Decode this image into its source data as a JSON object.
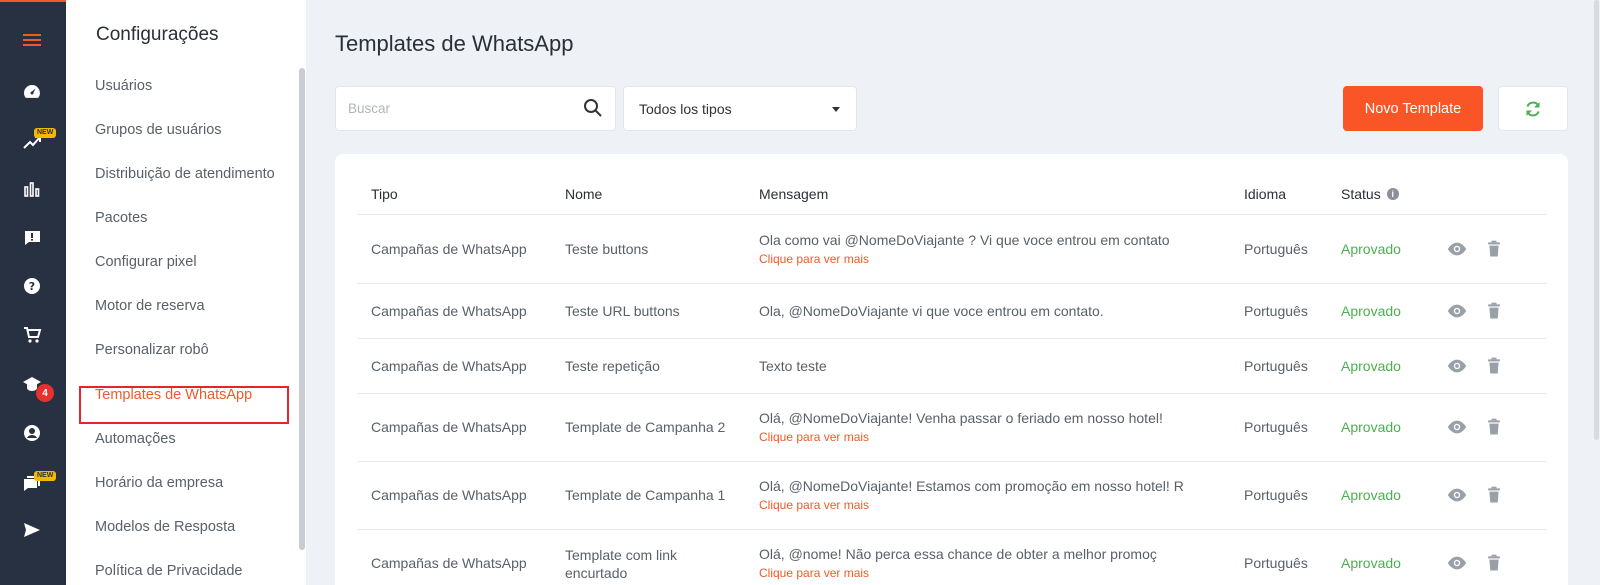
{
  "rail": {
    "new_badge": "NEW",
    "notification_count": "4",
    "colors": {
      "background": "#273142",
      "accent": "#f05a28"
    }
  },
  "settings": {
    "title": "Configurações",
    "items": [
      {
        "label": "Usuários"
      },
      {
        "label": "Grupos de usuários"
      },
      {
        "label": "Distribuição de atendimento"
      },
      {
        "label": "Pacotes"
      },
      {
        "label": "Configurar pixel"
      },
      {
        "label": "Motor de reserva"
      },
      {
        "label": "Personalizar robô"
      },
      {
        "label": "Templates de WhatsApp"
      },
      {
        "label": "Automações"
      },
      {
        "label": "Horário da empresa"
      },
      {
        "label": "Modelos de Resposta"
      },
      {
        "label": "Política de Privacidade"
      }
    ],
    "active_item": "Templates de WhatsApp"
  },
  "main": {
    "title": "Templates de WhatsApp",
    "search": {
      "placeholder": "Buscar",
      "value": ""
    },
    "type_filter": {
      "selected": "Todos los tipos"
    },
    "new_button": "Novo Template",
    "table": {
      "headers": {
        "tipo": "Tipo",
        "nome": "Nome",
        "mensagem": "Mensagem",
        "idioma": "Idioma",
        "status": "Status"
      },
      "rows": [
        {
          "tipo": "Campañas de WhatsApp",
          "nome": "Teste buttons",
          "mensagem": "Ola como vai @NomeDoViajante ? Vi que voce entrou em contato",
          "more": "Clique para ver mais",
          "idioma": "Português",
          "status": "Aprovado"
        },
        {
          "tipo": "Campañas de WhatsApp",
          "nome": "Teste URL buttons",
          "mensagem": "Ola, @NomeDoViajante vi que voce entrou em contato.",
          "more": "",
          "idioma": "Português",
          "status": "Aprovado"
        },
        {
          "tipo": "Campañas de WhatsApp",
          "nome": "Teste repetição",
          "mensagem": "Texto teste",
          "more": "",
          "idioma": "Português",
          "status": "Aprovado"
        },
        {
          "tipo": "Campañas de WhatsApp",
          "nome": "Template de Campanha 2",
          "mensagem": "Olá, @NomeDoViajante! Venha passar o feriado em nosso hotel!",
          "more": "Clique para ver mais",
          "idioma": "Português",
          "status": "Aprovado"
        },
        {
          "tipo": "Campañas de WhatsApp",
          "nome": "Template de Campanha 1",
          "mensagem": "Olá, @NomeDoViajante! Estamos com promoção em nosso hotel! R",
          "more": "Clique para ver mais",
          "idioma": "Português",
          "status": "Aprovado"
        },
        {
          "tipo": "Campañas de WhatsApp",
          "nome": "Template com link encurtado",
          "nome_line1": "Template com link",
          "nome_line2": "encurtado",
          "mensagem": "Olá, @nome! Não perca essa chance de obter a melhor promoç",
          "more": "Clique para ver mais",
          "idioma": "Português",
          "status": "Aprovado"
        }
      ]
    }
  }
}
